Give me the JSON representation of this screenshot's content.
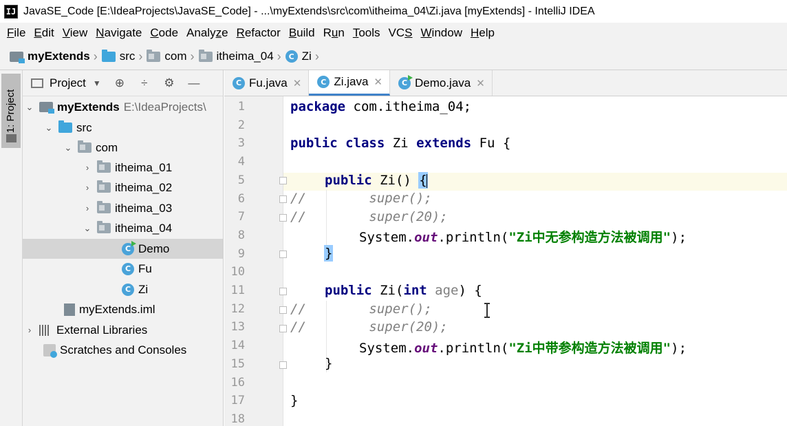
{
  "window": {
    "app_icon": "IJ",
    "title": "JavaSE_Code [E:\\IdeaProjects\\JavaSE_Code] - ...\\myExtends\\src\\com\\itheima_04\\Zi.java [myExtends] - IntelliJ IDEA"
  },
  "menu": [
    {
      "pre": "",
      "u": "F",
      "post": "ile"
    },
    {
      "pre": "",
      "u": "E",
      "post": "dit"
    },
    {
      "pre": "",
      "u": "V",
      "post": "iew"
    },
    {
      "pre": "",
      "u": "N",
      "post": "avigate"
    },
    {
      "pre": "",
      "u": "C",
      "post": "ode"
    },
    {
      "pre": "Analy",
      "u": "z",
      "post": "e"
    },
    {
      "pre": "",
      "u": "R",
      "post": "efactor"
    },
    {
      "pre": "",
      "u": "B",
      "post": "uild"
    },
    {
      "pre": "R",
      "u": "u",
      "post": "n"
    },
    {
      "pre": "",
      "u": "T",
      "post": "ools"
    },
    {
      "pre": "VC",
      "u": "S",
      "post": ""
    },
    {
      "pre": "",
      "u": "W",
      "post": "indow"
    },
    {
      "pre": "",
      "u": "H",
      "post": "elp"
    }
  ],
  "breadcrumb": {
    "module": "myExtends",
    "src": "src",
    "com": "com",
    "package": "itheima_04",
    "class_icon": "C",
    "class": "Zi"
  },
  "toolstrip": {
    "project_tab": "1: Project"
  },
  "project_panel": {
    "title": "Project",
    "tools": [
      "⊕",
      "÷",
      "⚙",
      "—"
    ],
    "tree": {
      "root_name": "myExtends",
      "root_path": "E:\\IdeaProjects\\",
      "src": "src",
      "com": "com",
      "pkg1": "itheima_01",
      "pkg2": "itheima_02",
      "pkg3": "itheima_03",
      "pkg4": "itheima_04",
      "class_demo": "Demo",
      "class_fu": "Fu",
      "class_zi": "Zi",
      "iml": "myExtends.iml",
      "libraries": "External Libraries",
      "scratches": "Scratches and Consoles",
      "class_icon": "C"
    }
  },
  "tabs": [
    {
      "label": "Fu.java",
      "icon": "C",
      "active": false
    },
    {
      "label": "Zi.java",
      "icon": "C",
      "active": true
    },
    {
      "label": "Demo.java",
      "icon": "C",
      "active": false
    }
  ],
  "editor": {
    "line_numbers": [
      "1",
      "2",
      "3",
      "4",
      "5",
      "6",
      "7",
      "8",
      "9",
      "10",
      "11",
      "12",
      "13",
      "14",
      "15",
      "16",
      "17",
      "18"
    ],
    "code": {
      "l1_kw": "package",
      "l1_rest": " com.itheima_04;",
      "l3_kw1": "public",
      "l3_kw2": "class",
      "l3_name": " Zi ",
      "l3_kw3": "extends",
      "l3_rest": " Fu {",
      "l5_kw": "public",
      "l5_rest": " Zi() ",
      "l5_brace": "{",
      "l6_cmt": "//        super();",
      "l7_cmt": "//        super(20);",
      "l8_sys": "System.",
      "l8_out": "out",
      "l8_call": ".println(",
      "l8_str": "\"Zi中无参构造方法被调用\"",
      "l8_end": ");",
      "l9_brace": "}",
      "l11_kw": "public",
      "l11_name": " Zi(",
      "l11_type": "int",
      "l11_param": " age",
      "l11_end": ") {",
      "l12_cmt": "//        super();",
      "l13_cmt": "//        super(20);",
      "l14_sys": "System.",
      "l14_out": "out",
      "l14_call": ".println(",
      "l14_str": "\"Zi中带参构造方法被调用\"",
      "l14_end": ");",
      "l15": "}",
      "l17": "}"
    }
  },
  "colors": {
    "keyword": "#000080",
    "static_field": "#660e7a",
    "string": "#008000",
    "comment": "#808080",
    "active_tab_underline": "#4083c9",
    "current_line": "#fcfae8"
  }
}
